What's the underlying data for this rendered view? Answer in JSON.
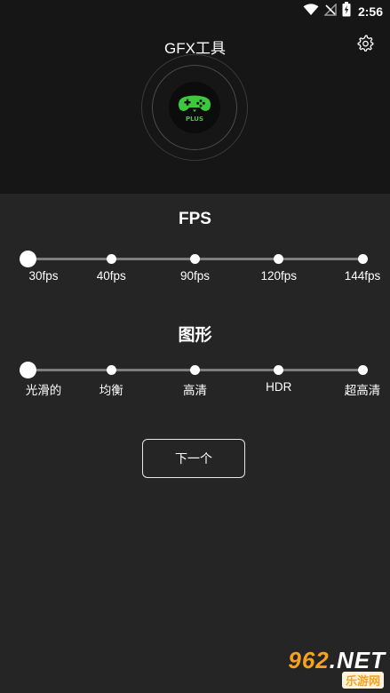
{
  "status_bar": {
    "time": "2:56",
    "icons": [
      "wifi-icon",
      "no-signal-icon",
      "battery-charging-icon"
    ]
  },
  "header": {
    "title": "GFX工具",
    "settings_icon": "gear-icon"
  },
  "logo": {
    "badge_text": "PLUS",
    "accent_color": "#3dc93d"
  },
  "fps_section": {
    "title": "FPS",
    "options": [
      "30fps",
      "40fps",
      "90fps",
      "120fps",
      "144fps"
    ],
    "selected_index": 0
  },
  "graphics_section": {
    "title": "图形",
    "options": [
      "光滑的",
      "均衡",
      "高清",
      "HDR",
      "超高清"
    ],
    "selected_index": 0
  },
  "actions": {
    "next_label": "下一个"
  },
  "watermark": {
    "number": "962",
    "suffix": ".NET",
    "sub": "乐游网"
  },
  "colors": {
    "hero_bg": "#161616",
    "body_bg": "#252525",
    "track": "#7d7d7d",
    "watermark_orange": "#f7a21b"
  }
}
